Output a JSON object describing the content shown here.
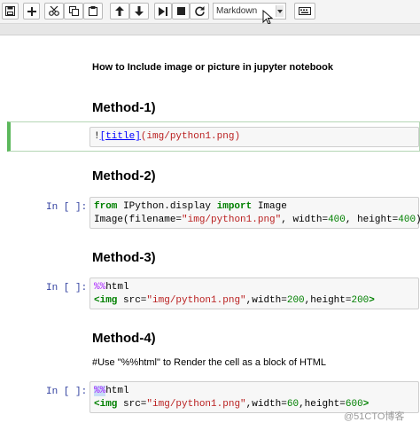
{
  "toolbar": {
    "buttons": [
      "save-icon",
      "add-cell-icon",
      "cut-icon",
      "copy-icon",
      "paste-icon",
      "move-up-icon",
      "move-down-icon",
      "run-icon",
      "stop-icon",
      "restart-icon",
      "keyboard-icon"
    ],
    "cell_type": "Markdown"
  },
  "notebook": {
    "title_text": "How to Include image or picture in jupyter notebook",
    "method1": {
      "heading": "Method-1)",
      "code": {
        "bang": "!",
        "link_text": "[title]",
        "path": "(img/python1.png)"
      }
    },
    "method2": {
      "heading": "Method-2)",
      "prompt": "In [ ]:",
      "line1": {
        "from": "from",
        "module": " IPython.display ",
        "import": "import",
        "name": " Image"
      },
      "line2": {
        "call": "Image(filename=",
        "path": "\"img/python1.png\"",
        "w_label": ", width=",
        "w": "400",
        "h_label": ", height=",
        "h": "400",
        "end": ")"
      }
    },
    "method3": {
      "heading": "Method-3)",
      "prompt": "In [ ]:",
      "line1": {
        "magic": "%%",
        "name": "html"
      },
      "line2": {
        "open": "<img",
        "src_label": " src=",
        "src": "\"img/python1.png\"",
        "w_label": ",width=",
        "w": "200",
        "h_label": ",height=",
        "h": "200",
        "close": ">"
      }
    },
    "method4": {
      "heading": "Method-4)",
      "description": "#Use \"%%html\" to Render the cell as a block of HTML",
      "prompt": "In [ ]:",
      "line1": {
        "magic": "%%",
        "name": "html"
      },
      "line2": {
        "open": "<img",
        "src_label": " src=",
        "src": "\"img/python1.png\"",
        "w_label": ",width=",
        "w": "60",
        "h_label": ",height=",
        "h": "600",
        "close": ">"
      }
    }
  },
  "watermark": "@51CTO博客",
  "colors": {
    "selected_cell_border": "#5cb85c",
    "prompt": "#303f9f",
    "keyword": "#008000",
    "string": "#ba2121"
  }
}
